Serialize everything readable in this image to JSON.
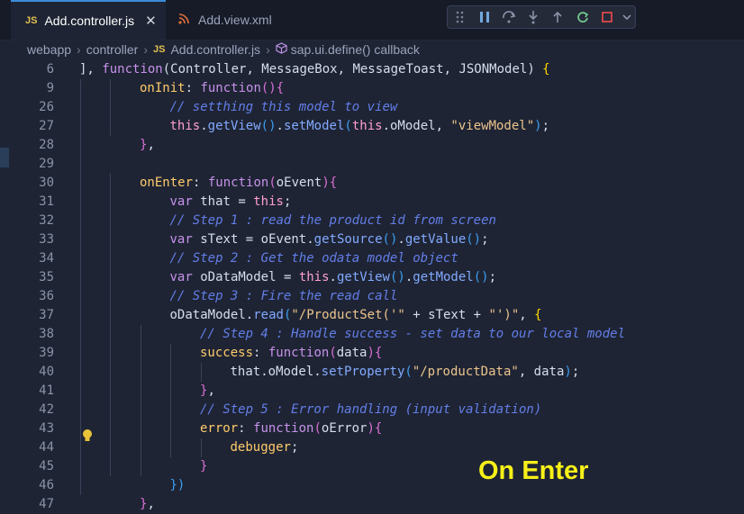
{
  "tabs": [
    {
      "lang": "JS",
      "label": "Add.controller.js",
      "close": "✕"
    },
    {
      "icon": "rss-xml-icon",
      "label": "Add.view.xml"
    }
  ],
  "debug_toolbar": {
    "icons": [
      "drag-handle-icon",
      "pause-icon",
      "step-over-icon",
      "step-into-icon",
      "step-out-icon",
      "restart-icon",
      "stop-icon",
      "chevron-down-icon"
    ]
  },
  "breadcrumb": {
    "items": [
      "webapp",
      "controller",
      "Add.controller.js",
      "sap.ui.define() callback"
    ],
    "sep": "›",
    "js_badge": "JS"
  },
  "lines": [
    {
      "n": "6",
      "indent": 0,
      "parts": [
        [
          "p",
          "], "
        ],
        [
          "kw",
          "function"
        ],
        [
          "p",
          "(Controller, MessageBox, MessageToast, JSONModel) "
        ],
        [
          "bp",
          "{"
        ]
      ]
    },
    {
      "n": "9",
      "indent": 2,
      "parts": [
        [
          "prop",
          "onInit"
        ],
        [
          "p",
          ": "
        ],
        [
          "kw",
          "function"
        ],
        [
          "bp2",
          "()"
        ],
        [
          "bp2",
          "{"
        ]
      ]
    },
    {
      "n": "26",
      "indent": 3,
      "parts": [
        [
          "cm",
          "// setthing this model to view"
        ]
      ]
    },
    {
      "n": "27",
      "indent": 3,
      "parts": [
        [
          "th",
          "this"
        ],
        [
          "p",
          "."
        ],
        [
          "fn",
          "getView"
        ],
        [
          "bp3",
          "()"
        ],
        [
          "p",
          "."
        ],
        [
          "fn",
          "setModel"
        ],
        [
          "bp3",
          "("
        ],
        [
          "th",
          "this"
        ],
        [
          "p",
          ".oModel, "
        ],
        [
          "str",
          "\"viewModel\""
        ],
        [
          "bp3",
          ")"
        ],
        [
          "p",
          ";"
        ]
      ]
    },
    {
      "n": "28",
      "indent": 2,
      "parts": [
        [
          "bp2",
          "}"
        ],
        [
          "p",
          ","
        ]
      ]
    },
    {
      "n": "29",
      "indent": 0,
      "parts": []
    },
    {
      "n": "30",
      "indent": 2,
      "parts": [
        [
          "prop",
          "onEnter"
        ],
        [
          "p",
          ": "
        ],
        [
          "kw",
          "function"
        ],
        [
          "bp2",
          "("
        ],
        [
          "p",
          "oEvent"
        ],
        [
          "bp2",
          ")"
        ],
        [
          "bp2",
          "{"
        ]
      ]
    },
    {
      "n": "31",
      "indent": 3,
      "parts": [
        [
          "kw",
          "var"
        ],
        [
          "p",
          " that = "
        ],
        [
          "th",
          "this"
        ],
        [
          "p",
          ";"
        ]
      ]
    },
    {
      "n": "32",
      "indent": 3,
      "parts": [
        [
          "cm",
          "// Step 1 : read the product id from screen"
        ]
      ]
    },
    {
      "n": "33",
      "indent": 3,
      "parts": [
        [
          "kw",
          "var"
        ],
        [
          "p",
          " sText = oEvent."
        ],
        [
          "fn",
          "getSource"
        ],
        [
          "bp3",
          "()"
        ],
        [
          "p",
          "."
        ],
        [
          "fn",
          "getValue"
        ],
        [
          "bp3",
          "()"
        ],
        [
          "p",
          ";"
        ]
      ]
    },
    {
      "n": "34",
      "indent": 3,
      "parts": [
        [
          "cm",
          "// Step 2 : Get the odata model object"
        ]
      ]
    },
    {
      "n": "35",
      "indent": 3,
      "parts": [
        [
          "kw",
          "var"
        ],
        [
          "p",
          " oDataModel = "
        ],
        [
          "th",
          "this"
        ],
        [
          "p",
          "."
        ],
        [
          "fn",
          "getView"
        ],
        [
          "bp3",
          "()"
        ],
        [
          "p",
          "."
        ],
        [
          "fn",
          "getModel"
        ],
        [
          "bp3",
          "()"
        ],
        [
          "p",
          ";"
        ]
      ]
    },
    {
      "n": "36",
      "indent": 3,
      "parts": [
        [
          "cm",
          "// Step 3 : Fire the read call"
        ]
      ]
    },
    {
      "n": "37",
      "indent": 3,
      "parts": [
        [
          "p",
          "oDataModel."
        ],
        [
          "fn",
          "read"
        ],
        [
          "bp3",
          "("
        ],
        [
          "str",
          "\"/ProductSet('\""
        ],
        [
          "p",
          " + sText + "
        ],
        [
          "str",
          "\"')\""
        ],
        [
          "p",
          ", "
        ],
        [
          "bp",
          "{"
        ]
      ]
    },
    {
      "n": "38",
      "indent": 4,
      "parts": [
        [
          "cm",
          "// Step 4 : Handle success - set data to our local model"
        ]
      ]
    },
    {
      "n": "39",
      "indent": 4,
      "parts": [
        [
          "prop",
          "success"
        ],
        [
          "p",
          ": "
        ],
        [
          "kw",
          "function"
        ],
        [
          "bp2",
          "("
        ],
        [
          "p",
          "data"
        ],
        [
          "bp2",
          ")"
        ],
        [
          "bp2",
          "{"
        ]
      ]
    },
    {
      "n": "40",
      "indent": 5,
      "parts": [
        [
          "p",
          "that.oModel."
        ],
        [
          "fn",
          "setProperty"
        ],
        [
          "bp3",
          "("
        ],
        [
          "str",
          "\"/productData\""
        ],
        [
          "p",
          ", data"
        ],
        [
          "bp3",
          ")"
        ],
        [
          "p",
          ";"
        ]
      ]
    },
    {
      "n": "41",
      "indent": 4,
      "parts": [
        [
          "bp2",
          "}"
        ],
        [
          "p",
          ","
        ]
      ]
    },
    {
      "n": "42",
      "indent": 4,
      "parts": [
        [
          "cm",
          "// Step 5 : Error handling (input validation)"
        ]
      ]
    },
    {
      "n": "43",
      "indent": 4,
      "parts": [
        [
          "prop",
          "error"
        ],
        [
          "p",
          ": "
        ],
        [
          "kw",
          "function"
        ],
        [
          "bp2",
          "("
        ],
        [
          "p",
          "oError"
        ],
        [
          "bp2",
          ")"
        ],
        [
          "bp2",
          "{"
        ]
      ]
    },
    {
      "n": "44",
      "indent": 5,
      "parts": [
        [
          "prop",
          "debugger"
        ],
        [
          "p",
          ";"
        ]
      ]
    },
    {
      "n": "45",
      "indent": 4,
      "parts": [
        [
          "bp2",
          "}"
        ]
      ]
    },
    {
      "n": "46",
      "indent": 3,
      "parts": [
        [
          "bp3",
          "})"
        ]
      ]
    },
    {
      "n": "47",
      "indent": 2,
      "parts": [
        [
          "bp2",
          "}"
        ],
        [
          "p",
          ","
        ]
      ]
    }
  ],
  "overlay_text": "On Enter",
  "colors": {
    "accent": "#3c8bd9",
    "overlay": "#f7f018",
    "background": "#1e2434"
  }
}
